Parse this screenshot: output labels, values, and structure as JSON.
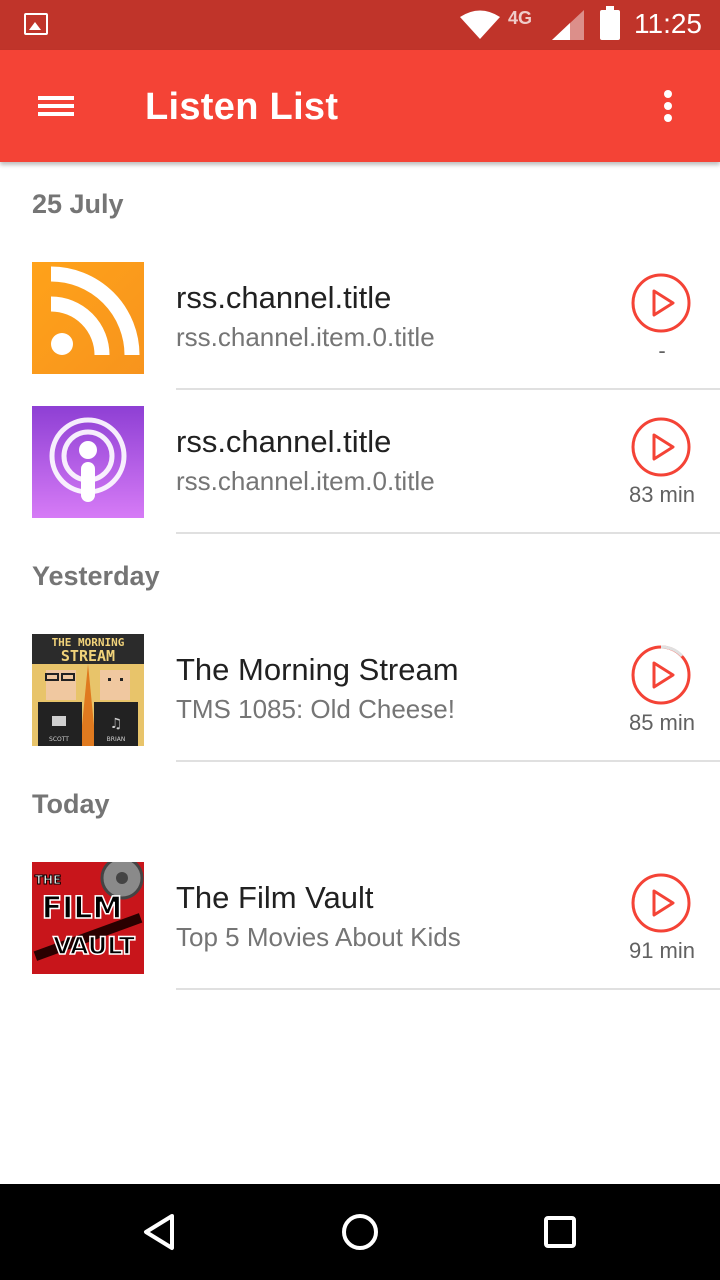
{
  "status_bar": {
    "network": "4G",
    "time": "11:25"
  },
  "app_bar": {
    "title": "Listen List",
    "menu_icon": "hamburger-menu-icon",
    "overflow_icon": "more-vert-icon"
  },
  "accent_color": "#f44336",
  "sections": [
    {
      "header": "25 July",
      "items": [
        {
          "title": "rss.channel.title",
          "subtitle": "rss.channel.item.0.title",
          "duration": "-",
          "progress": 0,
          "art": "rss-feed"
        },
        {
          "title": "rss.channel.title",
          "subtitle": "rss.channel.item.0.title",
          "duration": "83 min",
          "progress": 0,
          "art": "podcast"
        }
      ]
    },
    {
      "header": "Yesterday",
      "items": [
        {
          "title": "The Morning Stream",
          "subtitle": "TMS 1085: Old Cheese!",
          "duration": "85 min",
          "progress": 0.12,
          "art": "morning-stream"
        }
      ]
    },
    {
      "header": "Today",
      "items": [
        {
          "title": "The Film Vault",
          "subtitle": "Top 5 Movies About Kids",
          "duration": "91 min",
          "progress": 0,
          "art": "film-vault"
        }
      ]
    }
  ],
  "artwork_text": {
    "morning_stream": [
      "THE MORNING",
      "STREAM",
      "SCOTT",
      "BRIAN"
    ],
    "film_vault": [
      "THE",
      "FILM",
      "VAULT"
    ]
  },
  "nav_bar": {
    "back_icon": "back-triangle-icon",
    "home_icon": "home-circle-icon",
    "recents_icon": "recents-square-icon"
  }
}
